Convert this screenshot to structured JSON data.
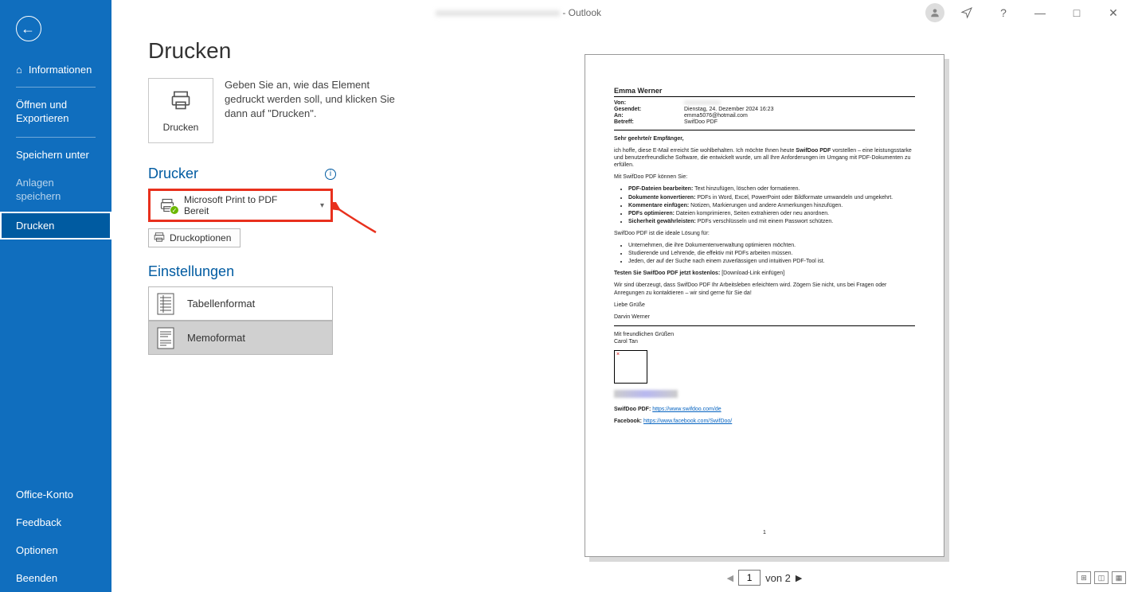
{
  "titlebar": {
    "app": "Outlook"
  },
  "sidebar": {
    "info": "Informationen",
    "open": "Öffnen und Exportieren",
    "saveas": "Speichern unter",
    "attach": "Anlagen speichern",
    "print": "Drucken",
    "account": "Office-Konto",
    "feedback": "Feedback",
    "options": "Optionen",
    "exit": "Beenden"
  },
  "page": {
    "title": "Drucken",
    "print_btn": "Drucken",
    "desc": "Geben Sie an, wie das Element gedruckt werden soll, und klicken Sie dann auf \"Drucken\".",
    "printer_section": "Drucker",
    "printer_name": "Microsoft Print to PDF",
    "printer_status": "Bereit",
    "print_options": "Druckoptionen",
    "settings_section": "Einstellungen",
    "table_format": "Tabellenformat",
    "memo_format": "Memoformat"
  },
  "pager": {
    "current": "1",
    "total": "von 2"
  },
  "email": {
    "name": "Emma Werner",
    "from_lab": "Von:",
    "sent_lab": "Gesendet:",
    "sent_val": "Dienstag, 24. Dezember 2024 16:23",
    "to_lab": "An:",
    "to_val": "emma5076@hotmail.com",
    "subj_lab": "Betreff:",
    "subj_val": "SwifDoo PDF",
    "greet": "Sehr geehrte/r Empfänger,",
    "intro": "ich hoffe, diese E-Mail erreicht Sie wohlbehalten. Ich möchte Ihnen heute SwifDoo PDF vorstellen – eine leistungsstarke und benutzerfreundliche Software, die entwickelt wurde, um all Ihre Anforderungen im Umgang mit PDF-Dokumenten zu erfüllen.",
    "can": "Mit SwifDoo PDF können Sie:",
    "feat": [
      {
        "b": "PDF-Dateien bearbeiten:",
        "t": " Text hinzufügen, löschen oder formatieren."
      },
      {
        "b": "Dokumente konvertieren:",
        "t": " PDFs in Word, Excel, PowerPoint oder Bildformate umwandeln und umgekehrt."
      },
      {
        "b": "Kommentare einfügen:",
        "t": " Notizen, Markierungen und andere Anmerkungen hinzufügen."
      },
      {
        "b": "PDFs optimieren:",
        "t": " Dateien komprimieren, Seiten extrahieren oder neu anordnen."
      },
      {
        "b": "Sicherheit gewährleisten:",
        "t": " PDFs verschlüsseln und mit einem Passwort schützen."
      }
    ],
    "ideal": "SwifDoo PDF ist die ideale Lösung für:",
    "aud": [
      "Unternehmen, die ihre Dokumentenverwaltung optimieren möchten.",
      "Studierende und Lehrende, die effektiv mit PDFs arbeiten müssen.",
      "Jeden, der auf der Suche nach einem zuverlässigen und intuitiven PDF-Tool ist."
    ],
    "cta_b": "Testen Sie SwifDoo PDF jetzt kostenlos:",
    "cta_l": " [Download-Link einfügen]",
    "close": "Wir sind überzeugt, dass SwifDoo PDF Ihr Arbeitsleben erleichtern wird. Zögern Sie nicht, uns bei Fragen oder Anregungen zu kontaktieren – wir sind gerne für Sie da!",
    "bye": "Liebe Grüße",
    "sender": "Darvin Werner",
    "sig1": "Mit freundlichen Grüßen",
    "sig2": "Carol Tan",
    "link1_lab": "SwifDoo PDF:",
    "link1": "https://www.swifdoo.com/de",
    "link2_lab": "Facebook:",
    "link2": "https://www.facebook.com/SwifDoo/",
    "pgnum": "1"
  }
}
